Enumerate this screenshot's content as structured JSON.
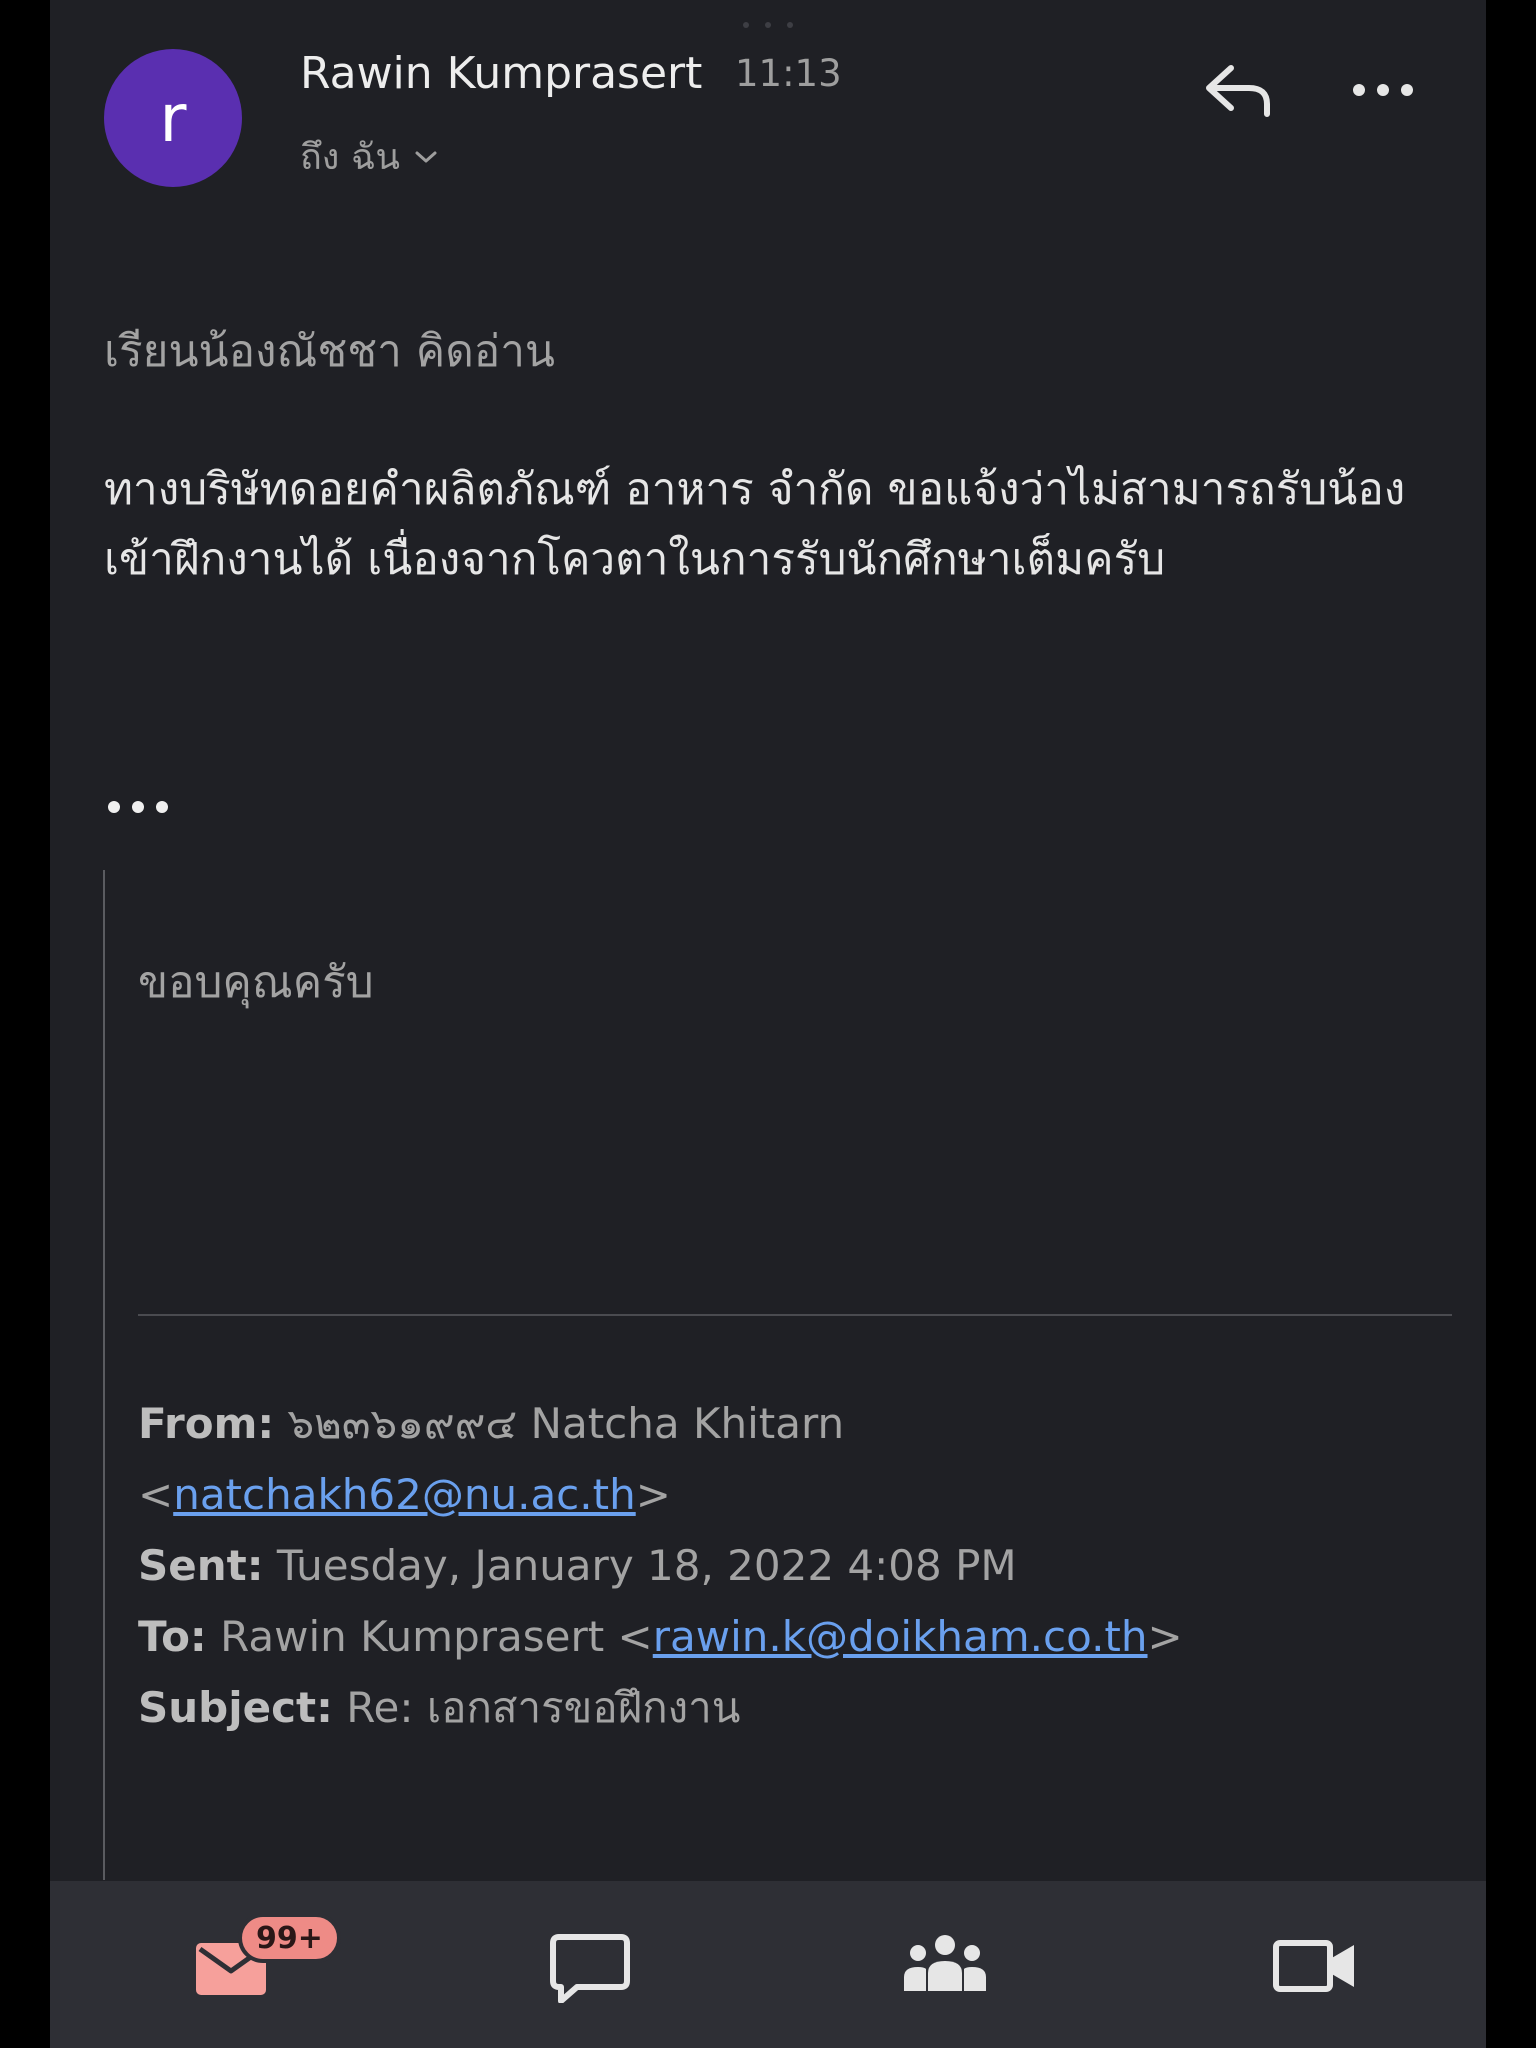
{
  "email": {
    "avatar_letter": "r",
    "sender_name": "Rawin Kumprasert",
    "time": "11:13",
    "recipient": "ถึง ฉัน",
    "greeting": "เรียนน้องณัชชา คิดอ่าน",
    "message": "ทางบริษัทดอยคำผลิตภัณฑ์ อาหาร จำกัด ขอแจ้งว่าไม่สามารถรับน้องเข้าฝึกงานได้ เนื่องจากโควตาในการรับนักศึกษาเต็มครับ",
    "quoted": {
      "thanks": "ขอบคุณครับ",
      "from_label": "From:",
      "from_name": "๖๒๓๖๑๙๙๔ Natcha Khitarn",
      "from_email": "natchakh62@nu.ac.th",
      "sent_label": "Sent:",
      "sent_value": "Tuesday, January 18, 2022 4:08 PM",
      "to_label": "To:",
      "to_name": "Rawin Kumprasert",
      "to_email": "rawin.k@doikham.co.th",
      "subject_label": "Subject:",
      "subject_value": "Re: เอกสารขอฝึกงาน"
    }
  },
  "nav": {
    "mail_badge": "99+",
    "items": [
      "mail-icon",
      "chat-icon",
      "meet-icon",
      "video-icon"
    ]
  },
  "colors": {
    "background": "#1f2025",
    "avatar": "#5a2fb0",
    "link": "#6aa0ee",
    "badge": "#ee8b86",
    "mail_icon": "#f6a09b"
  }
}
